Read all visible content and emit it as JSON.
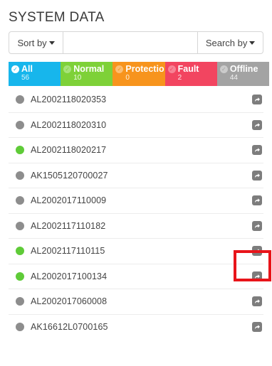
{
  "page": {
    "title": "SYSTEM DATA"
  },
  "toolbar": {
    "sort_label": "Sort by",
    "search_value": "",
    "search_by_label": "Search by"
  },
  "status_tabs": [
    {
      "label": "All",
      "count": "56",
      "color": "#17b6ec",
      "check_color": "#ffffff",
      "check_fg": "#17b6ec"
    },
    {
      "label": "Normal",
      "count": "10",
      "color": "#7ed138",
      "check_color": "#a7e27a",
      "check_fg": "#7ed138"
    },
    {
      "label": "Protectio",
      "count": "0",
      "color": "#f7941d",
      "check_color": "#fbbe73",
      "check_fg": "#f7941d"
    },
    {
      "label": "Fault",
      "count": "2",
      "color": "#f24560",
      "check_color": "#f78395",
      "check_fg": "#f24560"
    },
    {
      "label": "Offline",
      "count": "44",
      "color": "#a3a3a3",
      "check_color": "#cbcbcb",
      "check_fg": "#a3a3a3"
    }
  ],
  "status_colors": {
    "online": "#5fcb38",
    "offline": "#8d8d8d"
  },
  "devices": [
    {
      "id": "AL2002118020353",
      "status": "offline"
    },
    {
      "id": "AL2002118020310",
      "status": "offline"
    },
    {
      "id": "AL2002118020217",
      "status": "online"
    },
    {
      "id": "AK1505120700027",
      "status": "offline"
    },
    {
      "id": "AL2002017110009",
      "status": "offline"
    },
    {
      "id": "AL2002117110182",
      "status": "offline"
    },
    {
      "id": "AL2002117110115",
      "status": "online"
    },
    {
      "id": "AL2002017100134",
      "status": "online"
    },
    {
      "id": "AL2002017060008",
      "status": "offline"
    },
    {
      "id": "AK16612L0700165",
      "status": "offline"
    }
  ],
  "highlight_color": "#e8141a"
}
